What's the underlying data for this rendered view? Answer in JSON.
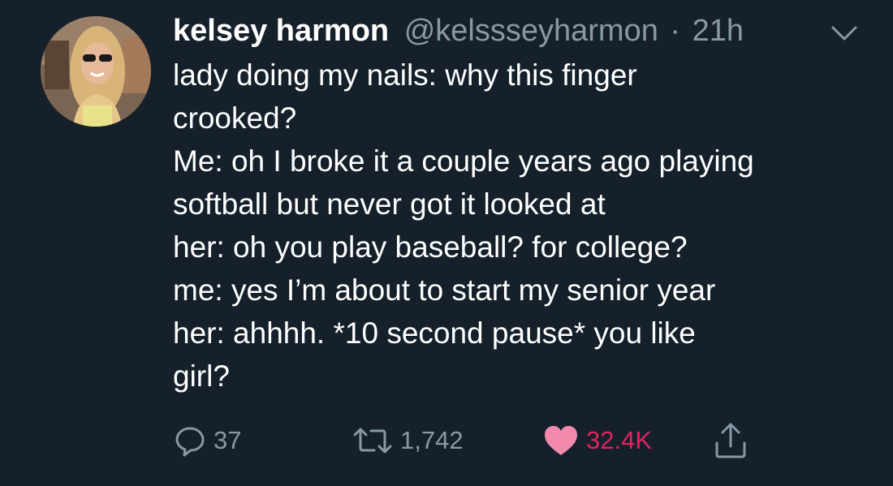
{
  "tweet": {
    "display_name": "kelsey harmon",
    "handle": "@kelssseyharmon",
    "separator": "·",
    "time": "21h",
    "lines": [
      "lady doing my nails: why this finger",
      "crooked?",
      "Me: oh I broke it a couple years ago playing",
      "softball but never got it looked at",
      "her: oh you play baseball? for college?",
      "me: yes I’m about to start my senior year",
      "her: ahhhh. *10 second pause* you like",
      "girl?"
    ],
    "reply_count": "37",
    "retweet_count": "1,742",
    "like_count": "32.4K"
  },
  "icons": {
    "reply": "reply-icon",
    "retweet": "retweet-icon",
    "like": "heart-icon",
    "share": "share-icon",
    "menu": "chevron-down-icon"
  },
  "colors": {
    "background": "#15202b",
    "text": "#ffffff",
    "secondary": "#8899a6",
    "like": "#e0245e"
  }
}
